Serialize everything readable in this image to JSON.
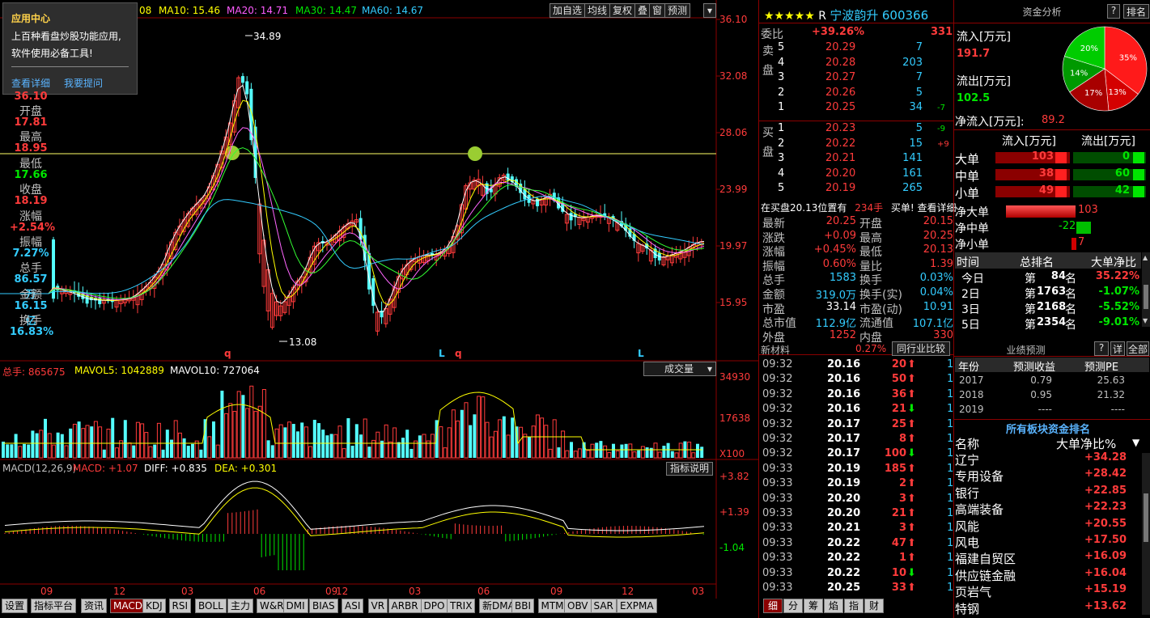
{
  "header": {
    "ma_prefix": "08",
    "ma5_value": "",
    "ma10": "MA10: 15.46",
    "ma20": "MA20: 14.71",
    "ma30": "MA30: 14.47",
    "ma60": "MA60: 14.67",
    "buttons": [
      "加自选",
      "均线",
      "复权",
      "叠",
      "窗",
      "预测"
    ]
  },
  "popup": {
    "title": "应用中心",
    "line1": "上百种看盘炒股功能应用,",
    "line2": "软件使用必备工具!",
    "link1": "查看详细",
    "link2": "我要提问"
  },
  "left_panel": {
    "close_prev": "36.10",
    "items": [
      [
        "开盘",
        "17.81"
      ],
      [
        "最高",
        "18.95"
      ],
      [
        "最低",
        "17.66"
      ],
      [
        "收盘",
        "18.19"
      ],
      [
        "涨幅",
        "+2.54%"
      ],
      [
        "振幅",
        "7.27%"
      ],
      [
        "总手",
        "86.57万"
      ],
      [
        "金额",
        "16.15亿"
      ],
      [
        "换手",
        "16.83%"
      ]
    ]
  },
  "price_axis": [
    "36.10",
    "32.08",
    "28.06",
    "23.99",
    "19.97",
    "15.95"
  ],
  "price_annot": {
    "high": "34.89",
    "low": "13.08"
  },
  "markers": [
    "q",
    "L",
    "q",
    "L"
  ],
  "volume_header": {
    "total": "总手: 865675",
    "mavol5": "MAVOL5: 1042889",
    "mavol10": "MAVOL10: 727064",
    "dropdown": "成交量"
  },
  "volume_axis": [
    "34930",
    "17638",
    "X100"
  ],
  "macd_header": {
    "name": "MACD(12,26,9)",
    "macd": "MACD: +1.07",
    "diff": "DIFF: +0.835",
    "dea": "DEA: +0.301",
    "btn": "指标说明"
  },
  "macd_axis": [
    "+3.82",
    "+1.39",
    "-1.04"
  ],
  "x_axis": [
    "09",
    "12",
    "03",
    "06",
    "09",
    "12",
    "03",
    "06",
    "09",
    "12",
    "03"
  ],
  "bottom_tabs": [
    "设置",
    "指标平台",
    "资讯",
    "MACD",
    "KDJ",
    "RSI",
    "BOLL",
    "主力",
    "W&R",
    "DMI",
    "BIAS",
    "ASI",
    "VR",
    "ARBR",
    "DPO",
    "TRIX",
    "新DMA",
    "BBI",
    "MTM",
    "OBV",
    "SAR",
    "EXPMA"
  ],
  "stock": {
    "stars": "★★★★★",
    "flag": "R",
    "name": "宁波韵升",
    "code": "600366"
  },
  "weibi": {
    "label": "委比",
    "pct": "+39.26%",
    "diff": "331"
  },
  "sell": {
    "label": "卖盘",
    "rows": [
      [
        "5",
        "20.29",
        "7",
        ""
      ],
      [
        "4",
        "20.28",
        "203",
        ""
      ],
      [
        "3",
        "20.27",
        "7",
        ""
      ],
      [
        "2",
        "20.26",
        "5",
        ""
      ],
      [
        "1",
        "20.25",
        "34",
        "-7"
      ]
    ]
  },
  "buy": {
    "label": "买盘",
    "rows": [
      [
        "1",
        "20.23",
        "5",
        "-9"
      ],
      [
        "2",
        "20.22",
        "15",
        "+9"
      ],
      [
        "3",
        "20.21",
        "141",
        ""
      ],
      [
        "4",
        "20.20",
        "161",
        ""
      ],
      [
        "5",
        "20.19",
        "265",
        ""
      ]
    ]
  },
  "buy_note": {
    "text": "在买盘20.13位置有",
    "amt": "234手",
    "link": "买单! 查看详细"
  },
  "quote": [
    [
      "最新",
      "20.25",
      "开盘",
      "20.15"
    ],
    [
      "涨跌",
      "+0.09",
      "最高",
      "20.25"
    ],
    [
      "涨幅",
      "+0.45%",
      "最低",
      "20.13"
    ],
    [
      "振幅",
      "0.60%",
      "量比",
      "1.39"
    ],
    [
      "总手",
      "1583",
      "换手",
      "0.03%"
    ],
    [
      "金额",
      "319.0万",
      "换手(实)",
      "0.04%"
    ],
    [
      "市盈",
      "33.14",
      "市盈(动)",
      "10.91"
    ],
    [
      "总市值",
      "112.9亿",
      "流通值",
      "107.1亿"
    ],
    [
      "外盘",
      "1252",
      "内盘",
      "330"
    ]
  ],
  "sector": {
    "name": "新材料",
    "pct": "0.27%",
    "btn": "同行业比较"
  },
  "ticks": [
    [
      "09:32",
      "20.16",
      "20",
      "up",
      "1"
    ],
    [
      "09:32",
      "20.16",
      "50",
      "up",
      "1"
    ],
    [
      "09:32",
      "20.16",
      "36",
      "up",
      "1"
    ],
    [
      "09:32",
      "20.16",
      "21",
      "down",
      "1"
    ],
    [
      "09:32",
      "20.17",
      "25",
      "up",
      "1"
    ],
    [
      "09:32",
      "20.17",
      "8",
      "up",
      "1"
    ],
    [
      "09:32",
      "20.17",
      "100",
      "down",
      "1"
    ],
    [
      "09:33",
      "20.19",
      "185",
      "up",
      "1"
    ],
    [
      "09:33",
      "20.19",
      "2",
      "up",
      "1"
    ],
    [
      "09:33",
      "20.20",
      "3",
      "up",
      "1"
    ],
    [
      "09:33",
      "20.20",
      "21",
      "up",
      "1"
    ],
    [
      "09:33",
      "20.21",
      "3",
      "up",
      "1"
    ],
    [
      "09:33",
      "20.22",
      "47",
      "up",
      "1"
    ],
    [
      "09:33",
      "20.22",
      "1",
      "up",
      "1"
    ],
    [
      "09:33",
      "20.22",
      "10",
      "down",
      "1"
    ],
    [
      "09:33",
      "20.25",
      "33",
      "up",
      "1"
    ]
  ],
  "right_tabs": [
    "细",
    "分",
    "筹",
    "焰",
    "指",
    "财"
  ],
  "fund": {
    "title": "资金分析",
    "btn1": "?",
    "btn2": "排名",
    "inflow_label": "流入[万元]",
    "inflow": "191.7",
    "outflow_label": "流出[万元]",
    "outflow": "102.5",
    "net_label": "净流入[万元]:",
    "net": "89.2",
    "pie": [
      {
        "label": "35%",
        "value": 35,
        "color": "#ff1a1a"
      },
      {
        "label": "13%",
        "value": 13,
        "color": "#d40000"
      },
      {
        "label": "17%",
        "value": 17,
        "color": "#a80000"
      },
      {
        "label": "14%",
        "value": 14,
        "color": "#009900"
      },
      {
        "label": "20%",
        "value": 20,
        "color": "#00cc00"
      }
    ],
    "col_in": "流入[万元]",
    "col_out": "流出[万元]",
    "rows": [
      [
        "大单",
        "103",
        "0"
      ],
      [
        "中单",
        "38",
        "60"
      ],
      [
        "小单",
        "49",
        "42"
      ]
    ],
    "net_rows": [
      [
        "净大单",
        "103"
      ],
      [
        "净中单",
        "-22"
      ],
      [
        "净小单",
        "7"
      ]
    ]
  },
  "rank": {
    "h_time": "时间",
    "h_rank": "总排名",
    "h_net": "大单净比",
    "rows": [
      [
        "今日",
        "第",
        "84",
        "名",
        "35.22%"
      ],
      [
        "2日",
        "第",
        "1763",
        "名",
        "-1.07%"
      ],
      [
        "3日",
        "第",
        "2168",
        "名",
        "-5.52%"
      ],
      [
        "5日",
        "第",
        "2354",
        "名",
        "-9.01%"
      ]
    ]
  },
  "forecast": {
    "title": "业绩预测",
    "btn1": "?",
    "btn2": "详",
    "btn3": "全部",
    "h1": "年份",
    "h2": "预测收益",
    "h3": "预测PE",
    "rows": [
      [
        "2017",
        "0.79",
        "25.63"
      ],
      [
        "2018",
        "0.95",
        "21.32"
      ],
      [
        "2019",
        "----",
        "----"
      ]
    ]
  },
  "sectors": {
    "title": "所有板块资金排名",
    "h1": "名称",
    "h2": "大单净比%",
    "rows": [
      [
        "辽宁",
        "+34.28"
      ],
      [
        "专用设备",
        "+28.42"
      ],
      [
        "银行",
        "+22.85"
      ],
      [
        "高端装备",
        "+22.23"
      ],
      [
        "风能",
        "+20.55"
      ],
      [
        "风电",
        "+17.50"
      ],
      [
        "福建自贸区",
        "+16.09"
      ],
      [
        "供应链金融",
        "+16.04"
      ],
      [
        "页岩气",
        "+15.19"
      ],
      [
        "特钢",
        "+13.62"
      ]
    ]
  }
}
